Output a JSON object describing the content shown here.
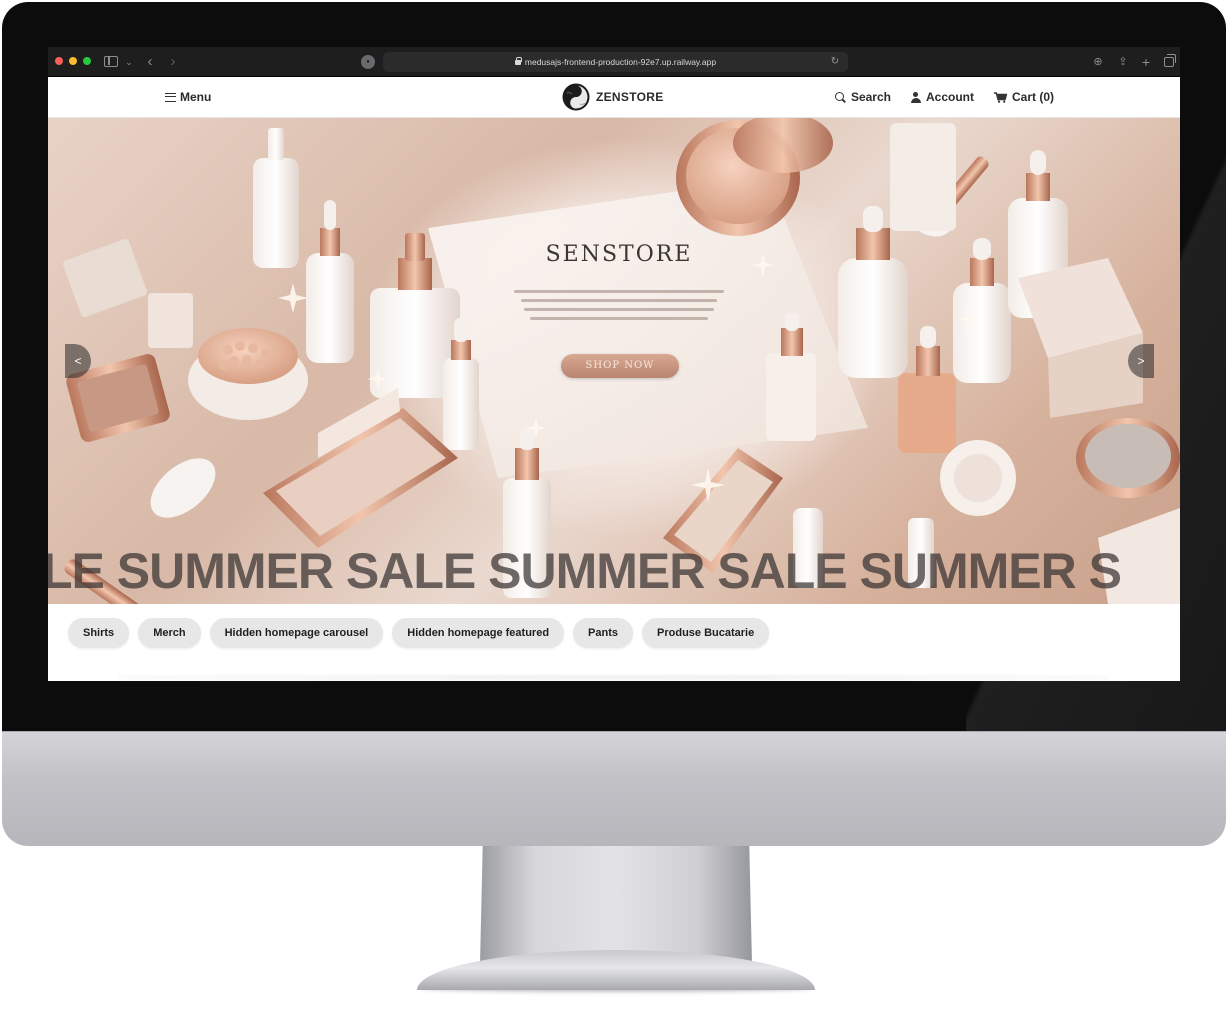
{
  "browser": {
    "url": "medusajs-frontend-production-92e7.up.railway.app"
  },
  "header": {
    "menu_label": "Menu",
    "brand_name": "ZENSTORE",
    "search_label": "Search",
    "account_label": "Account",
    "cart_label": "Cart (0)"
  },
  "hero": {
    "title": "SENSTORE",
    "cta_label": "SHOP NOW",
    "prev_label": "<",
    "next_label": ">",
    "marquee_text": "LE SUMMER SALE SUMMER SALE SUMMER S"
  },
  "categories": [
    {
      "label": "Shirts"
    },
    {
      "label": "Merch"
    },
    {
      "label": "Hidden homepage carousel"
    },
    {
      "label": "Hidden homepage featured"
    },
    {
      "label": "Pants"
    },
    {
      "label": "Produse Bucatarie"
    }
  ],
  "colors": {
    "bezel": "#0c0c0d",
    "hero_accent": "#b98470",
    "chip_bg": "#e7e7e7"
  }
}
